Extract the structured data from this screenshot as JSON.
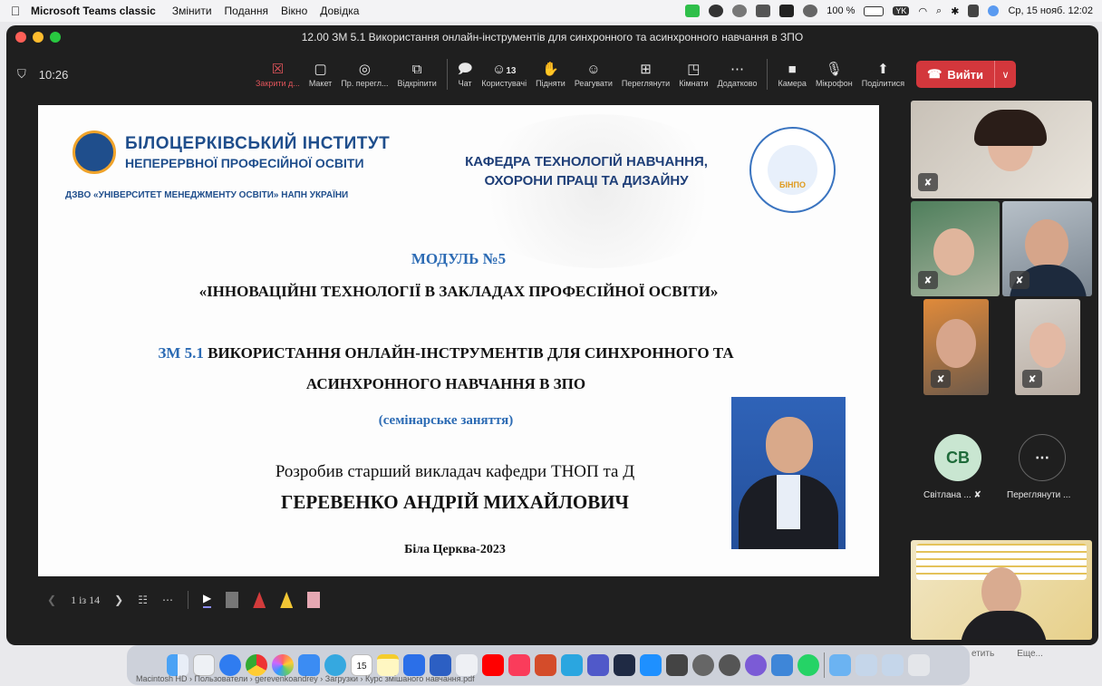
{
  "menubar": {
    "apple": "",
    "app_name": "Microsoft Teams classic",
    "menus": [
      "Змінити",
      "Подання",
      "Вікно",
      "Довідка"
    ],
    "battery": "100 %",
    "datetime": "Ср, 15 нояб.  12:02",
    "keyboard": "YK"
  },
  "window": {
    "title": "12.00 ЗМ 5.1 Використання онлайн-інструментів для синхронного та асинхронного навчання в ЗПО"
  },
  "toolbar": {
    "timer": "10:26",
    "buttons": [
      {
        "icon": "close-share-icon",
        "label": "Закрити д..."
      },
      {
        "icon": "layout-icon",
        "label": "Макет"
      },
      {
        "icon": "presenter-view-icon",
        "label": "Пр. перегл..."
      },
      {
        "icon": "popout-icon",
        "label": "Відкріпити"
      },
      {
        "icon": "chat-icon",
        "label": "Чат"
      },
      {
        "icon": "people-icon",
        "label": "Користувачі",
        "count": "13"
      },
      {
        "icon": "raise-hand-icon",
        "label": "Підняти"
      },
      {
        "icon": "react-icon",
        "label": "Реагувати"
      },
      {
        "icon": "view-icon",
        "label": "Переглянути"
      },
      {
        "icon": "rooms-icon",
        "label": "Кімнати"
      },
      {
        "icon": "more-icon",
        "label": "Додатково"
      },
      {
        "icon": "camera-icon",
        "label": "Камера"
      },
      {
        "icon": "mic-icon",
        "label": "Мікрофон"
      },
      {
        "icon": "share-icon",
        "label": "Поділитися"
      }
    ],
    "leave_label": "Вийти"
  },
  "slide": {
    "inst_line1": "БІЛОЦЕРКІВСЬКИЙ ІНСТИТУТ",
    "inst_line2": "НЕПЕРЕРВНОЇ ПРОФЕСІЙНОЇ ОСВІТИ",
    "inst_line3": "ДЗВО «УНІВЕРСИТЕТ МЕНЕДЖМЕНТУ ОСВІТИ» НАПН УКРАЇНИ",
    "kafedra_line1": "КАФЕДРА ТЕХНОЛОГІЙ НАВЧАННЯ,",
    "kafedra_line2": "ОХОРОНИ ПРАЦІ ТА ДИЗАЙНУ",
    "badge_text": "БІНПО",
    "module": "МОДУЛЬ №5",
    "innov": "«ІННОВАЦІЙНІ ТЕХНОЛОГІЇ В ЗАКЛАДАХ ПРОФЕСІЙНОЇ ОСВІТИ»",
    "zm_code": "ЗМ 5.1",
    "zm_line1": " ВИКОРИСТАННЯ ОНЛАЙН-ІНСТРУМЕНТІВ ДЛЯ СИНХРОННОГО ТА",
    "zm_line2": "АСИНХРОННОГО НАВЧАННЯ В ЗПО",
    "seminar": "(семінарське заняття)",
    "author_line1": "Розробив старший викладач кафедри ТНОП та Д",
    "author_line2": "ГЕРЕВЕНКО АНДРІЙ МИХАЙЛОВИЧ",
    "city": "Біла Церква-2023"
  },
  "presentation": {
    "page": "1 із 14"
  },
  "participants": {
    "cv_initials": "СВ",
    "cv_name": "Світлана ...",
    "more_label": "Переглянути ..."
  },
  "dock": {
    "calendar_day": "15",
    "path": "Macintosh HD › Пользователи › gerevenkoandrey › Загрузки › Курс змішаного навчання.pdf",
    "right_text1": "етить",
    "right_text2": "Еще..."
  }
}
